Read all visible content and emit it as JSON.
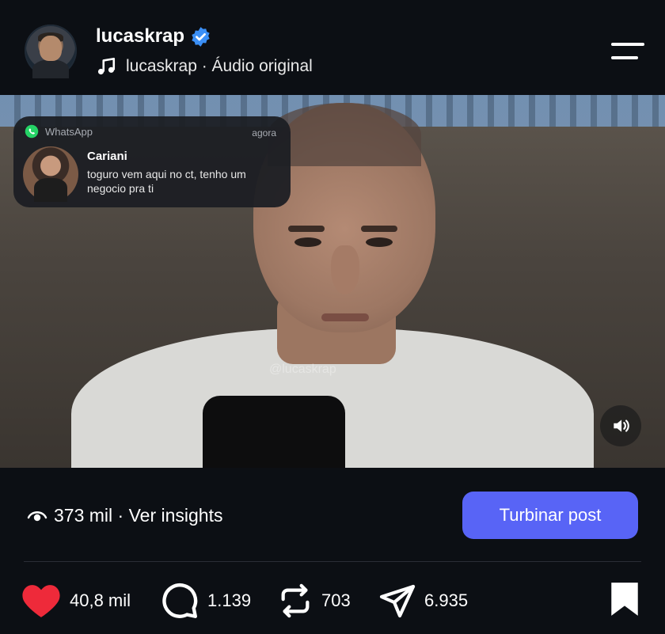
{
  "header": {
    "username": "lucaskrap",
    "audio_label": "lucaskrap · Áudio original",
    "verified_icon": "verified-badge-icon",
    "music_icon": "music-note-icon",
    "menu_icon": "menu-icon"
  },
  "media": {
    "watermark": "@lucaskrap",
    "sound_icon": "speaker-icon"
  },
  "notification": {
    "app_name": "WhatsApp",
    "time": "agora",
    "sender": "Cariani",
    "message": "toguro vem aqui no ct, tenho um negocio pra ti",
    "app_icon": "whatsapp-icon"
  },
  "insights": {
    "text": "373 mil · Ver insights",
    "icon": "eye-icon",
    "boost_label": "Turbinar post"
  },
  "actions": {
    "likes": "40,8 mil",
    "comments": "1.139",
    "reposts": "703",
    "shares": "6.935"
  },
  "colors": {
    "background": "#0c0f14",
    "accent_button": "#5864f6",
    "like_red": "#ee2a3a",
    "verified_blue": "#3b8ff6",
    "whatsapp_green": "#25d366"
  }
}
